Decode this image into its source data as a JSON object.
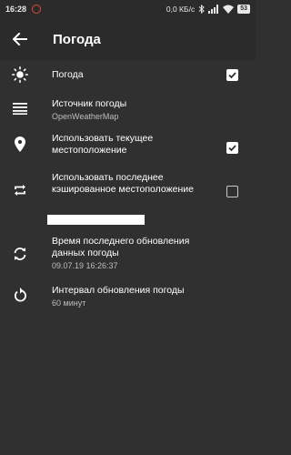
{
  "status_bar": {
    "time": "16:28",
    "speed": "0,0 КБ/с",
    "battery": "53"
  },
  "app_bar": {
    "title": "Погода",
    "back_icon": "arrow-left-icon"
  },
  "settings": [
    {
      "icon": "sun-icon",
      "primary": "Погода",
      "checkbox": true
    },
    {
      "icon": "list-icon",
      "primary": "Источник погоды",
      "secondary": "OpenWeatherMap"
    },
    {
      "icon": "location-pin-icon",
      "primary": "Использовать текущее местоположение",
      "checkbox": true
    },
    {
      "icon": "repeat-icon",
      "primary": "Использовать последнее кэшированное местоположение",
      "checkbox": false
    },
    {
      "icon": "sync-icon",
      "primary": "Время последнего обновления данных погоды",
      "secondary": "09.07.19 16:26:37"
    },
    {
      "icon": "refresh-icon",
      "primary": "Интервал обновления погоды",
      "secondary": "60 минут"
    }
  ]
}
